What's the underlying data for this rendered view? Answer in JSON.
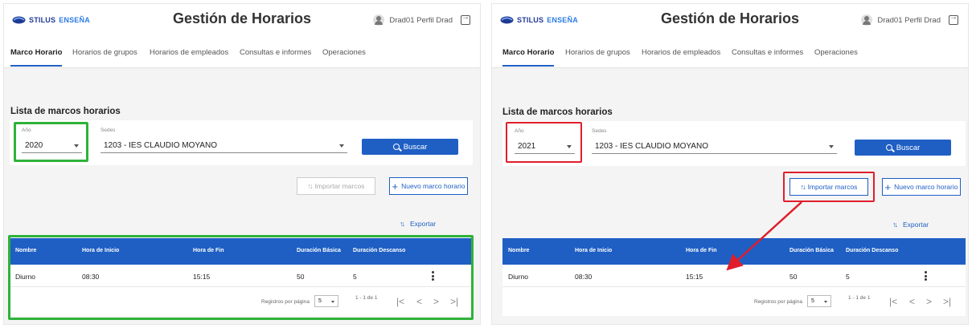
{
  "app": {
    "logo_part1": "STILUS",
    "logo_part2": "ENSEÑA",
    "title": "Gestión de Horarios",
    "user": "Drad01 Perfil Drad"
  },
  "nav": {
    "tabs": [
      "Marco Horario",
      "Horarios de grupos",
      "Horarios de empleados",
      "Consultas e informes",
      "Operaciones"
    ],
    "active": "Marco Horario"
  },
  "list_title": "Lista de marcos horarios",
  "filters": {
    "year_label": "Año",
    "sede_label": "Sedes",
    "sede_value": "1203 - IES CLAUDIO MOYANO",
    "search_label": "Buscar"
  },
  "actions": {
    "import_label": "Importar marcos",
    "new_label": "Nuevo marco horario",
    "export_label": "Exportar"
  },
  "table": {
    "headers": [
      "Nombre",
      "Hora de Inicio",
      "Hora de Fin",
      "Duración Básica",
      "Duración Descanso"
    ],
    "rows": [
      [
        "Diurno",
        "08:30",
        "15:15",
        "50",
        "5"
      ]
    ],
    "per_page_label": "Registros por página",
    "per_page_value": "5",
    "range": "1 - 1 de 1"
  },
  "left": {
    "year_value": "2020",
    "import_enabled": false
  },
  "right": {
    "year_value": "2021",
    "import_enabled": true
  },
  "colors": {
    "accent": "#1f5fc4",
    "highlight_left": "#2fb23a",
    "highlight_right": "#e01e2b"
  }
}
